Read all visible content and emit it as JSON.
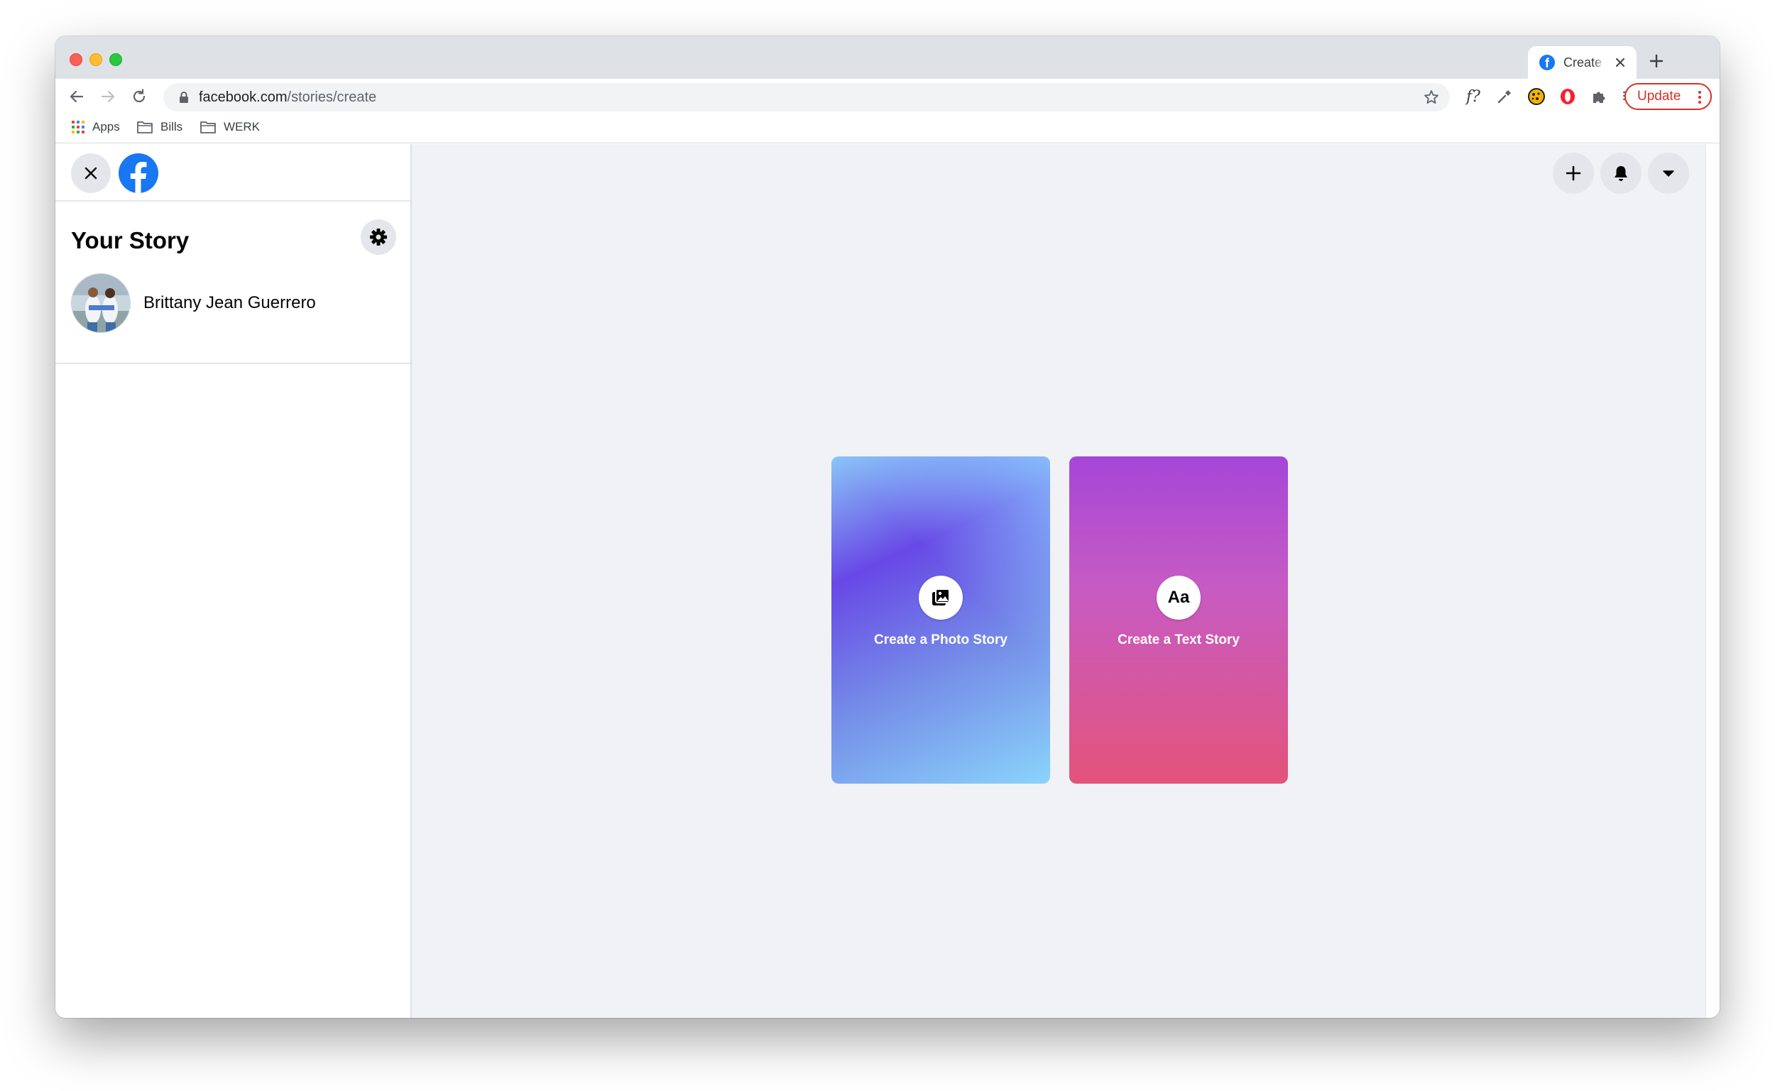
{
  "browser": {
    "tab_title": "Create",
    "url_domain": "facebook.com",
    "url_path": "/stories/create",
    "update_label": "Update",
    "extension_text": "f?",
    "bookmarks": [
      {
        "label": "Apps",
        "icon": "apps-grid-icon"
      },
      {
        "label": "Bills",
        "icon": "folder-icon"
      },
      {
        "label": "WERK",
        "icon": "folder-icon"
      }
    ]
  },
  "sidebar": {
    "title": "Your Story",
    "user_name": "Brittany Jean Guerrero"
  },
  "cards": {
    "photo_label": "Create a Photo Story",
    "text_label": "Create a Text Story",
    "text_icon": "Aa"
  },
  "colors": {
    "facebook_blue": "#1877f2",
    "update_red": "#d93025",
    "page_bg": "#f0f2f5"
  }
}
